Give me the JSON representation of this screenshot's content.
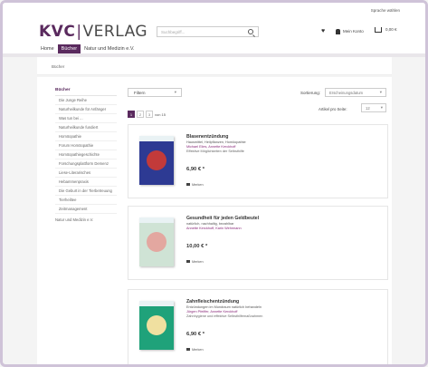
{
  "header": {
    "language": "Sprache wählen",
    "logo_bold": "KVC",
    "logo_divider": "|",
    "logo_rest": "VERLAG",
    "search_placeholder": "Suchbegriff...",
    "account_label": "Mein Konto",
    "cart_total": "0,00 €"
  },
  "nav": {
    "items": [
      "Home",
      "Bücher",
      "Natur und Medizin e.V."
    ],
    "active_index": 1
  },
  "breadcrumb": "Bücher",
  "sidebar": {
    "title": "Bücher",
    "items": [
      "Die Junge Reihe",
      "Naturheilkunde für Anfänger",
      "Was tun bei ...",
      "Naturheilkunde fundiert",
      "Homöopathie",
      "Forum Homöopathie",
      "Homöopathiegeschichte",
      "Forschungsplattform Demenz",
      "Liese-Literarisches",
      "Hebammenpraxis",
      "Die Geburt in der Tierbetreuung",
      "Tierheiltee",
      "Zeitmanagement"
    ],
    "root": "Natur und Medizin e.V."
  },
  "toolbar": {
    "filter_label": "Filtern",
    "sort_label": "Sortierung:",
    "sort_value": "Erscheinungsdatum",
    "pages": [
      "1",
      "2",
      "3",
      "von 15"
    ],
    "current_page": "1",
    "per_page_label": "Artikel pro Seite:",
    "per_page_value": "12"
  },
  "products": [
    {
      "title": "Blasenentzündung",
      "subtitle": "Hausmittel, Heilpflanzen, Homöopathie",
      "authors": "Michael Elies, Annette Kerckhoff",
      "description": "Effektive Möglichkeiten der Selbsthilfe",
      "price": "6,90 € *",
      "remember": "Merken",
      "cover_color": "#2d3a93",
      "cover_art_color": "#c23a3a"
    },
    {
      "title": "Gesundheit für jeden Geldbeutel",
      "subtitle": "natürlich, nachhaltig, bezahlbar",
      "authors": "Annette Kerckhoff, Karin Wehrmann",
      "description": "",
      "price": "10,00 € *",
      "remember": "Merken",
      "cover_color": "#cfe3d5",
      "cover_art_color": "#e3a7a0"
    },
    {
      "title": "Zahnfleischentzündung",
      "subtitle": "Entzündungen im Mundraum natürlich behandeln",
      "authors": "Jürgen Pfeiffer, Annette Kerckhoff",
      "description": "Zahnhygiene und effektive Selbsthilfemaßnahmen",
      "price": "6,90 € *",
      "remember": "Merken",
      "cover_color": "#1fa27a",
      "cover_art_color": "#f0e0a0"
    }
  ]
}
